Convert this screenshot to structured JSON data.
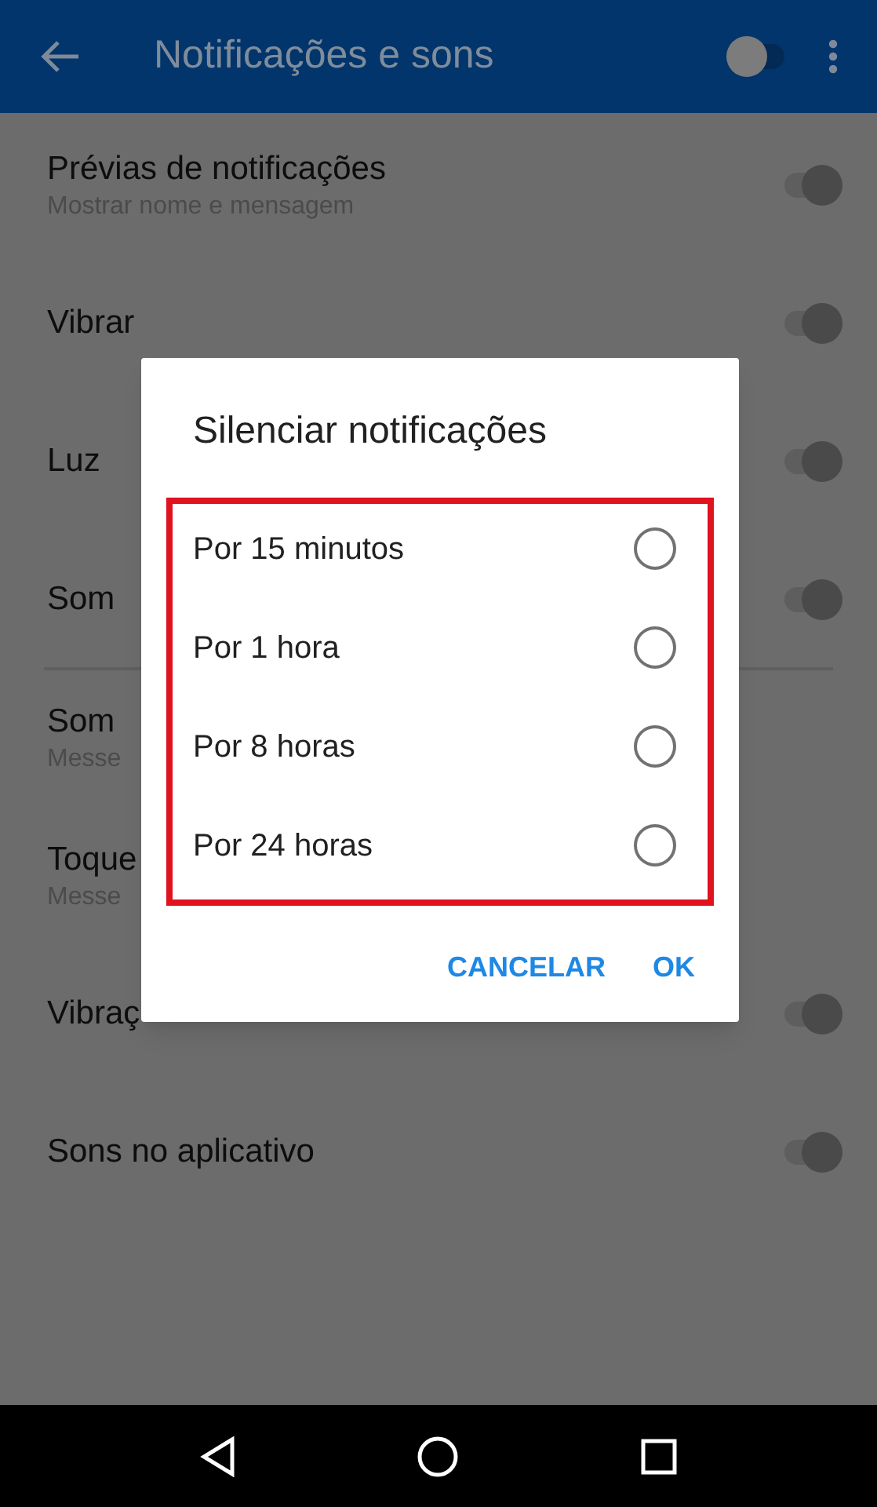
{
  "app_bar": {
    "title": "Notificações e sons",
    "on": false
  },
  "settings": [
    {
      "kind": "toggle",
      "title": "Prévias de notificações",
      "subtitle": "Mostrar nome e mensagem",
      "on": true
    },
    {
      "kind": "toggle",
      "title": "Vibrar",
      "on": true
    },
    {
      "kind": "toggle",
      "title": "Luz",
      "on": true
    },
    {
      "kind": "toggle",
      "title": "Som",
      "on": true
    },
    {
      "kind": "divider"
    },
    {
      "kind": "text",
      "title": "Som",
      "subtitle": "Messe"
    },
    {
      "kind": "text",
      "title": "Toque",
      "subtitle": "Messe"
    },
    {
      "kind": "toggle",
      "title": "Vibraç",
      "on": true
    },
    {
      "kind": "toggle",
      "title": "Sons no aplicativo",
      "on": true
    }
  ],
  "dialog": {
    "title": "Silenciar notificações",
    "options": [
      {
        "label": "Por 15 minutos",
        "selected": false
      },
      {
        "label": "Por 1 hora",
        "selected": false
      },
      {
        "label": "Por 8 horas",
        "selected": false
      },
      {
        "label": "Por 24 horas",
        "selected": false
      }
    ],
    "buttons": [
      "CANCELAR",
      "OK"
    ]
  }
}
